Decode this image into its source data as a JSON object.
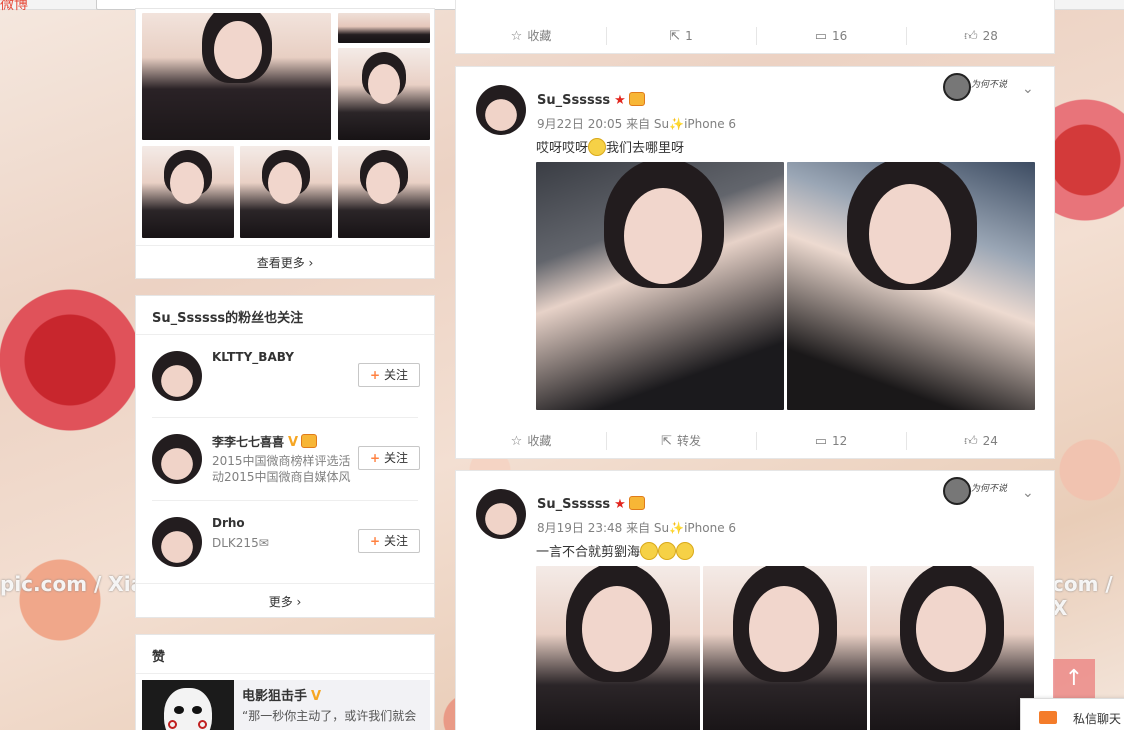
{
  "top": {
    "logo": "微博",
    "nav": [
      "",
      "",
      "",
      ""
    ]
  },
  "watermark": {
    "left": "pic.com / Xiao",
    "right": "com / X"
  },
  "left": {
    "photos_more": "查看更多 ›",
    "fans": {
      "title": "Su_Ssssss的粉丝也关注",
      "follow_label": "关注",
      "items": [
        {
          "name": "KLTTY_BABY",
          "desc": ""
        },
        {
          "name": "李李七七喜喜",
          "desc": "2015中国微商榜样评选活动2015中国微商自媒体风"
        },
        {
          "name": "Drho",
          "desc": "DLK215✉"
        }
      ],
      "more": "更多 ›"
    },
    "likes": {
      "title": "赞",
      "name": "电影狙击手",
      "desc": "“那一秒你主动了，或许我们就会"
    }
  },
  "posts": [
    {
      "actions": {
        "fav": "收藏",
        "share": "1",
        "comment": "16",
        "like": "28"
      }
    },
    {
      "user": "Su_Ssssss",
      "meta": "9月22日 20:05 来自 Su✨iPhone 6",
      "text_a": "哎呀哎呀",
      "text_b": "我们去哪里呀",
      "badge_text": "为何不说",
      "actions": {
        "fav": "收藏",
        "share": "转发",
        "comment": "12",
        "like": "24"
      }
    },
    {
      "user": "Su_Ssssss",
      "meta": "8月19日 23:48 来自 Su✨iPhone 6",
      "text_a": "一言不合就剪劉海",
      "badge_text": "为何不说"
    }
  ],
  "float": {
    "top_button": "↑",
    "chat": "私信聊天"
  },
  "icons": {
    "fav": "star-outline-icon",
    "share": "share-icon",
    "comment": "comment-icon",
    "like": "thumbs-up-icon"
  }
}
